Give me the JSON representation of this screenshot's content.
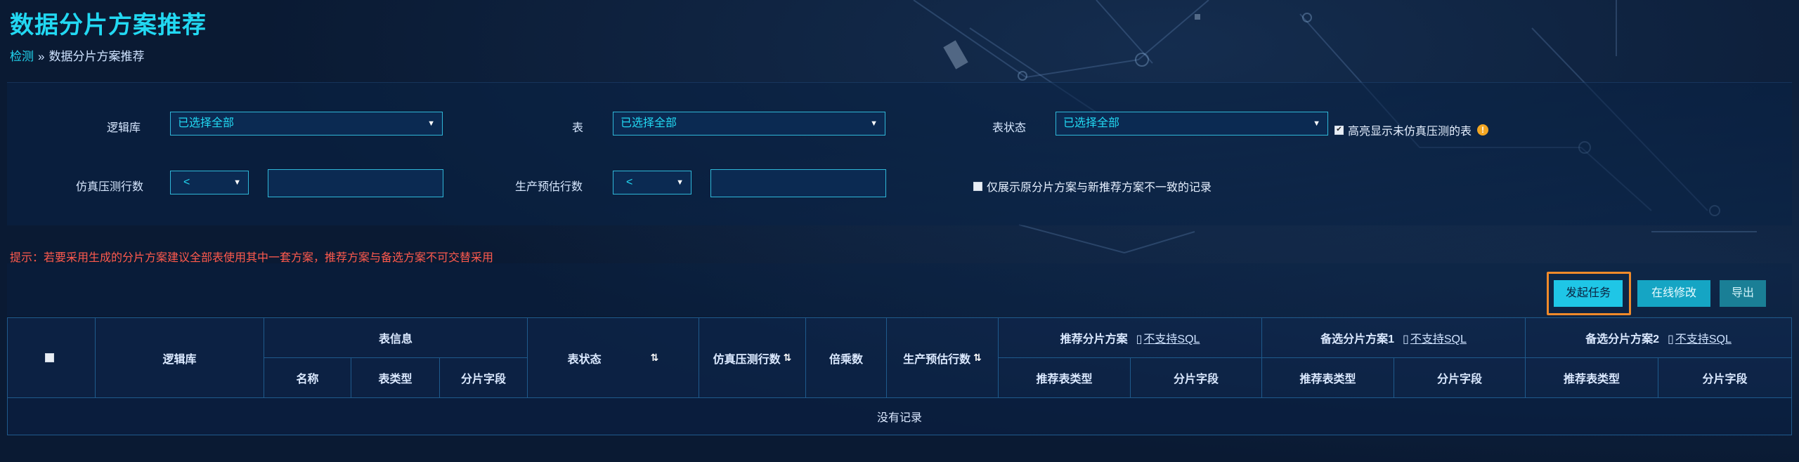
{
  "page": {
    "title": "数据分片方案推荐",
    "breadcrumb": {
      "root": "检测",
      "separator": "»",
      "current": "数据分片方案推荐"
    }
  },
  "filters": {
    "logic_db": {
      "label": "逻辑库",
      "value": "已选择全部"
    },
    "table": {
      "label": "表",
      "value": "已选择全部"
    },
    "table_status": {
      "label": "表状态",
      "value": "已选择全部"
    },
    "highlight_checkbox": {
      "label": "高亮显示未仿真压测的表",
      "checked": true,
      "info_icon": "!"
    },
    "sim_rows": {
      "label": "仿真压测行数",
      "operator": "<",
      "value": ""
    },
    "prod_rows": {
      "label": "生产预估行数",
      "operator": "<",
      "value": ""
    },
    "mismatch_checkbox": {
      "label": "仅展示原分片方案与新推荐方案不一致的记录",
      "checked": false
    }
  },
  "hint": "提示：若要采用生成的分片方案建议全部表使用其中一套方案，推荐方案与备选方案不可交替采用",
  "toolbar": {
    "start_task": "发起任务",
    "online_edit": "在线修改",
    "export": "导出"
  },
  "table": {
    "headers": {
      "logic_db": "逻辑库",
      "table_info": "表信息",
      "name": "名称",
      "table_type": "表类型",
      "shard_field": "分片字段",
      "table_status": "表状态",
      "sim_rows": "仿真压测行数",
      "multiplier": "倍乘数",
      "prod_rows": "生产预估行数",
      "recommend_plan": "推荐分片方案",
      "alt_plan_1": "备选分片方案1",
      "alt_plan_2": "备选分片方案2",
      "no_sql_link": "不支持SQL",
      "recommend_table_type": "推荐表类型",
      "plan_shard_field": "分片字段"
    },
    "sort_icon": "⇅",
    "empty_text": "没有记录"
  },
  "colors": {
    "accent": "#22d8f2",
    "warning": "#ff5a4e",
    "highlight_border": "#f08a2a"
  }
}
